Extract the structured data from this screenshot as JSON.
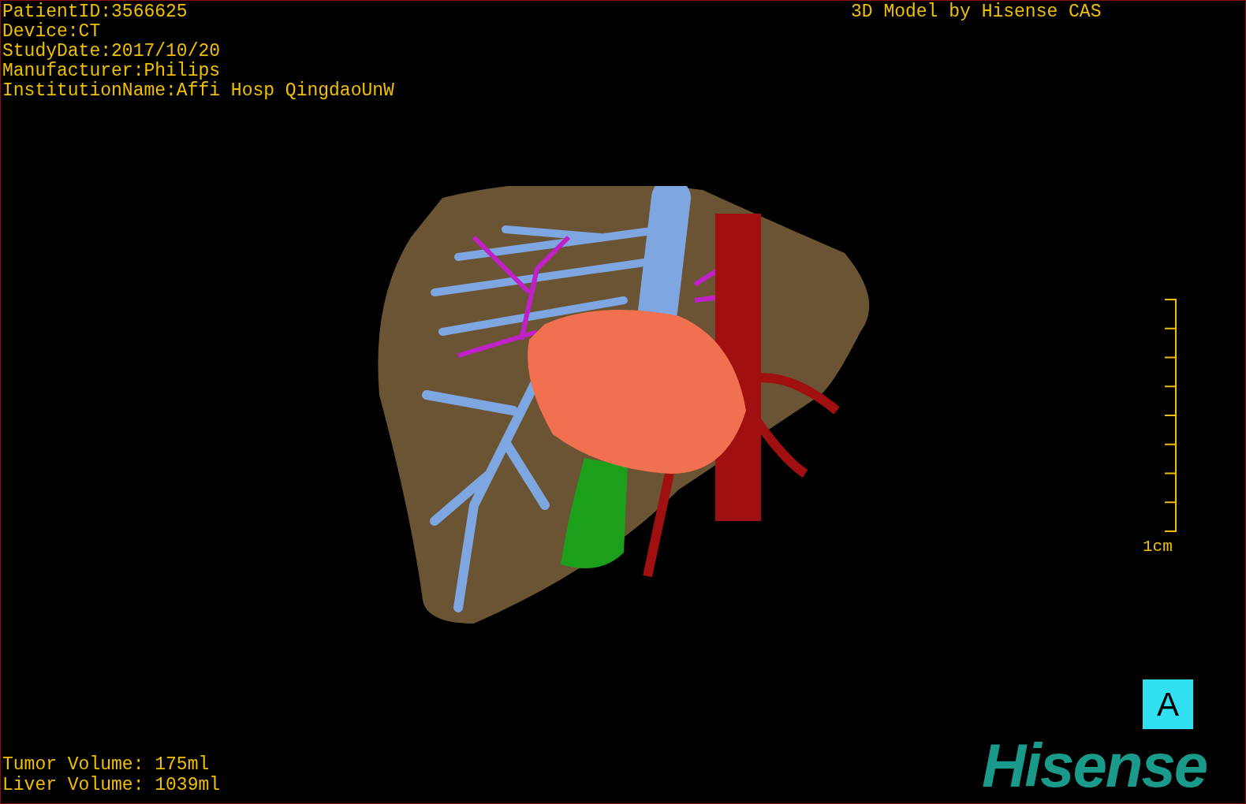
{
  "info_lines": [
    "PatientID:3566625",
    "Device:CT",
    "StudyDate:2017/10/20",
    "Manufacturer:Philips",
    "InstitutionName:Affi Hosp QingdaoUnW"
  ],
  "model_credit": "3D Model by Hisense CAS",
  "scale_bar": {
    "label": "1cm"
  },
  "orientation_marker": "A",
  "volumes": [
    "Tumor Volume: 175ml",
    "Liver Volume: 1039ml"
  ],
  "logo": "Hisense"
}
